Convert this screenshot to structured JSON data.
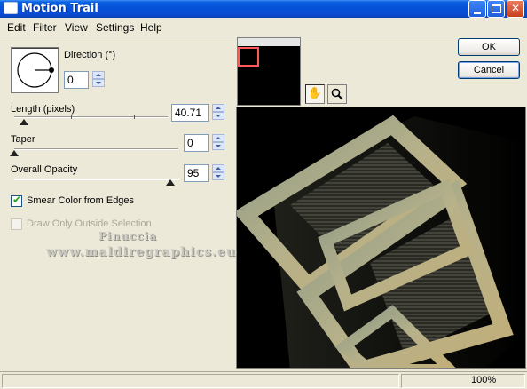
{
  "window": {
    "title": "Motion Trail"
  },
  "titlebar_buttons": {
    "minimize": "minimize",
    "maximize": "maximize",
    "close": "✕"
  },
  "menu": {
    "items": [
      "Edit",
      "Filter",
      "View",
      "Settings",
      "Help"
    ]
  },
  "direction": {
    "label": "Direction (°)",
    "value": "0"
  },
  "length": {
    "label": "Length (pixels)",
    "value": "40.71"
  },
  "taper": {
    "label": "Taper",
    "value": "0"
  },
  "opacity": {
    "label": "Overall Opacity",
    "value": "95"
  },
  "smear": {
    "label": "Smear Color from Edges",
    "checked": true
  },
  "draw_only": {
    "label": "Draw Only Outside Selection",
    "checked": false,
    "enabled": false
  },
  "watermark": {
    "line1": "Pinuccia",
    "line2": "www.maldiregraphics.eu"
  },
  "buttons": {
    "ok": "OK",
    "cancel": "Cancel"
  },
  "tools": {
    "pan": "pan-hand-icon",
    "zoom": "magnifier-icon"
  },
  "status": {
    "zoom": "100%"
  },
  "colors": {
    "title_blue": "#0551d9",
    "face": "#ece9d8",
    "check_green": "#21a121"
  }
}
